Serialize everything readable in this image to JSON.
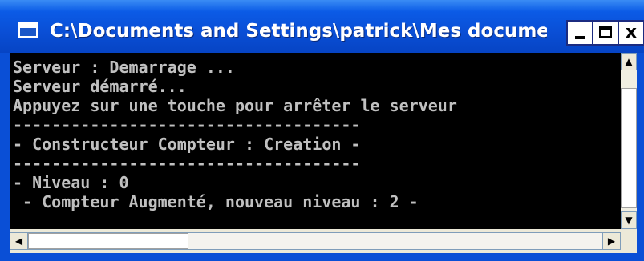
{
  "window": {
    "title": "C:\\Documents and Settings\\patrick\\Mes docume..."
  },
  "controls": {
    "minimize": "_",
    "maximize": "□",
    "close": "x"
  },
  "console": {
    "lines": [
      "Serveur : Demarrage ...",
      "Serveur démarré...",
      "Appuyez sur une touche pour arrêter le serveur",
      "------------------------------------",
      "- Constructeur Compteur : Creation -",
      "------------------------------------",
      "- Niveau : 0",
      " - Compteur Augmenté, nouveau niveau : 2 -",
      "_"
    ],
    "text_color": "#c0c0c0",
    "background": "#000000"
  },
  "scrollbars": {
    "up_icon": "▲",
    "down_icon": "▼",
    "left_icon": "◀",
    "right_icon": "▶"
  }
}
